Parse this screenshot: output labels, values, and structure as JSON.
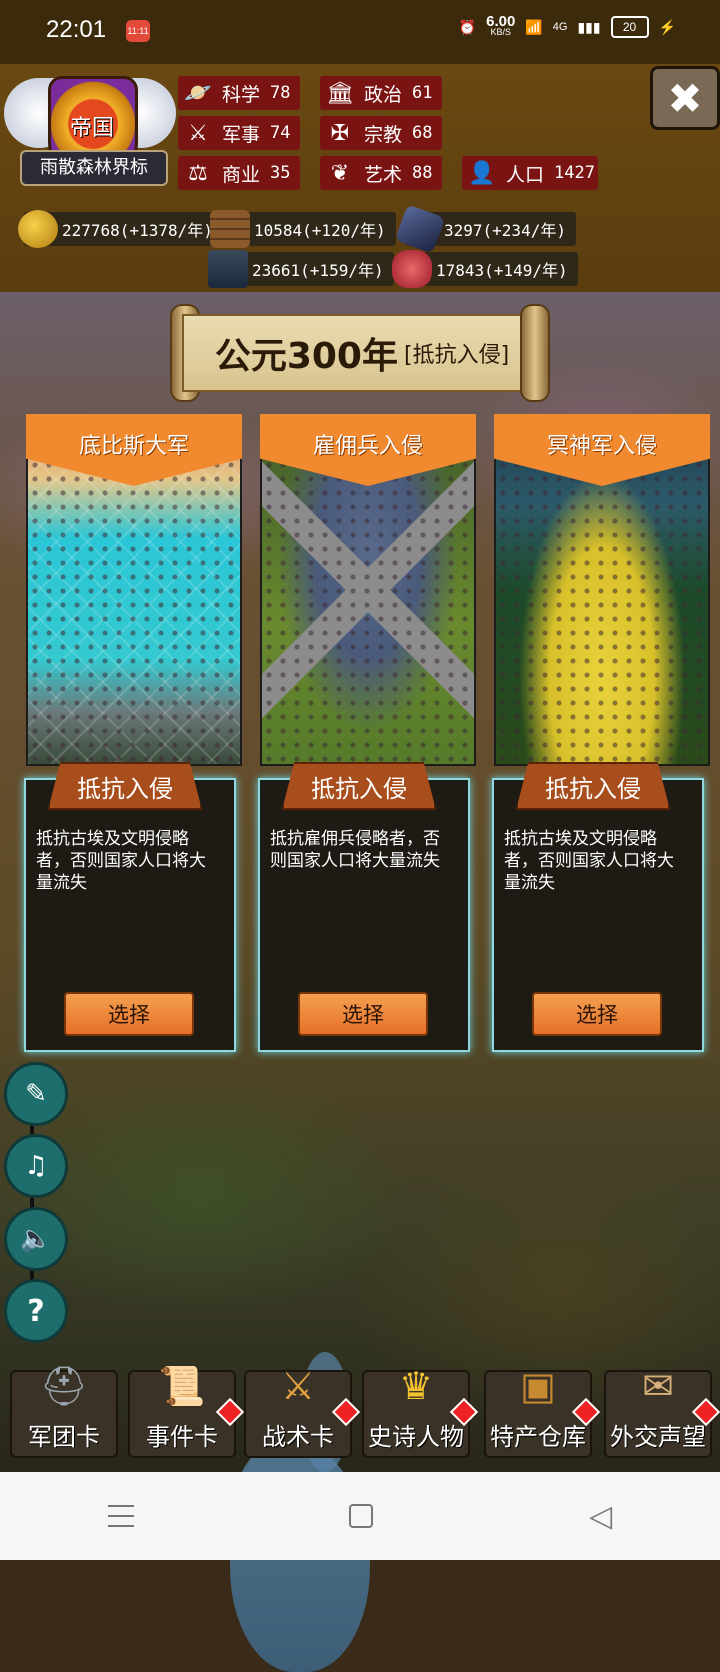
{
  "status_bar": {
    "time": "22:01",
    "notif_badge": "11:11",
    "alarm_icon": "alarm-icon",
    "speed_value": "6.00",
    "speed_unit": "KB/S",
    "network": "4G",
    "battery": "20"
  },
  "emblem": {
    "title": "帝国",
    "name": "雨散森林界标"
  },
  "stats": [
    {
      "label": "科学",
      "value": "78",
      "icon": "planet-icon"
    },
    {
      "label": "政治",
      "value": "61",
      "icon": "building-icon"
    },
    {
      "label": "军事",
      "value": "74",
      "icon": "crossed-swords-icon"
    },
    {
      "label": "宗教",
      "value": "68",
      "icon": "holy-cross-icon"
    },
    {
      "label": "商业",
      "value": "35",
      "icon": "scales-icon"
    },
    {
      "label": "艺术",
      "value": "88",
      "icon": "art-icon"
    },
    {
      "label": "人口",
      "value": "1427",
      "icon": "person-icon"
    }
  ],
  "resources": [
    {
      "name": "gold",
      "value": "227768(+1378/年)",
      "icon": "gold-coins-icon"
    },
    {
      "name": "wood",
      "value": "10584(+120/年)",
      "icon": "wood-logs-icon"
    },
    {
      "name": "stone",
      "value": "3297(+234/年)",
      "icon": "stone-icon"
    },
    {
      "name": "iron",
      "value": "23661(+159/年)",
      "icon": "iron-ingot-icon"
    },
    {
      "name": "meat",
      "value": "17843(+149/年)",
      "icon": "meat-icon"
    }
  ],
  "close_label": "✖",
  "year": {
    "text": "公元300年",
    "subtitle": "[抵抗入侵]"
  },
  "cards": [
    {
      "title": "底比斯大军",
      "tag": "抵抗入侵",
      "desc": "抵抗古埃及文明侵略者，否则国家人口将大量流失",
      "button": "选择"
    },
    {
      "title": "雇佣兵入侵",
      "tag": "抵抗入侵",
      "desc": "抵抗雇佣兵侵略者，否则国家人口将大量流失",
      "button": "选择"
    },
    {
      "title": "冥神军入侵",
      "tag": "抵抗入侵",
      "desc": "抵抗古埃及文明侵略者，否则国家人口将大量流失",
      "button": "选择"
    }
  ],
  "side_buttons": [
    {
      "icon": "book-quill-icon",
      "glyph": "✎"
    },
    {
      "icon": "music-off-icon",
      "glyph": "♫"
    },
    {
      "icon": "speaker-icon",
      "glyph": "🔈"
    },
    {
      "icon": "help-icon",
      "glyph": "?"
    }
  ],
  "nav": [
    {
      "label": "军团卡",
      "icon": "helmet-icon",
      "glyph": "⛑",
      "badge": false
    },
    {
      "label": "事件卡",
      "icon": "scroll-icon",
      "glyph": "📜",
      "badge": true
    },
    {
      "label": "战术卡",
      "icon": "shield-swords-icon",
      "glyph": "⚔",
      "badge": true
    },
    {
      "label": "史诗人物",
      "icon": "crown-icon",
      "glyph": "♛",
      "badge": true
    },
    {
      "label": "特产仓库",
      "icon": "chest-icon",
      "glyph": "▣",
      "badge": true
    },
    {
      "label": "外交声望",
      "icon": "envelope-icon",
      "glyph": "✉",
      "badge": true
    }
  ],
  "system_nav": {
    "menu_icon": "menu-icon",
    "home_icon": "home-icon",
    "back_icon": "back-icon",
    "back_glyph": "◁"
  }
}
